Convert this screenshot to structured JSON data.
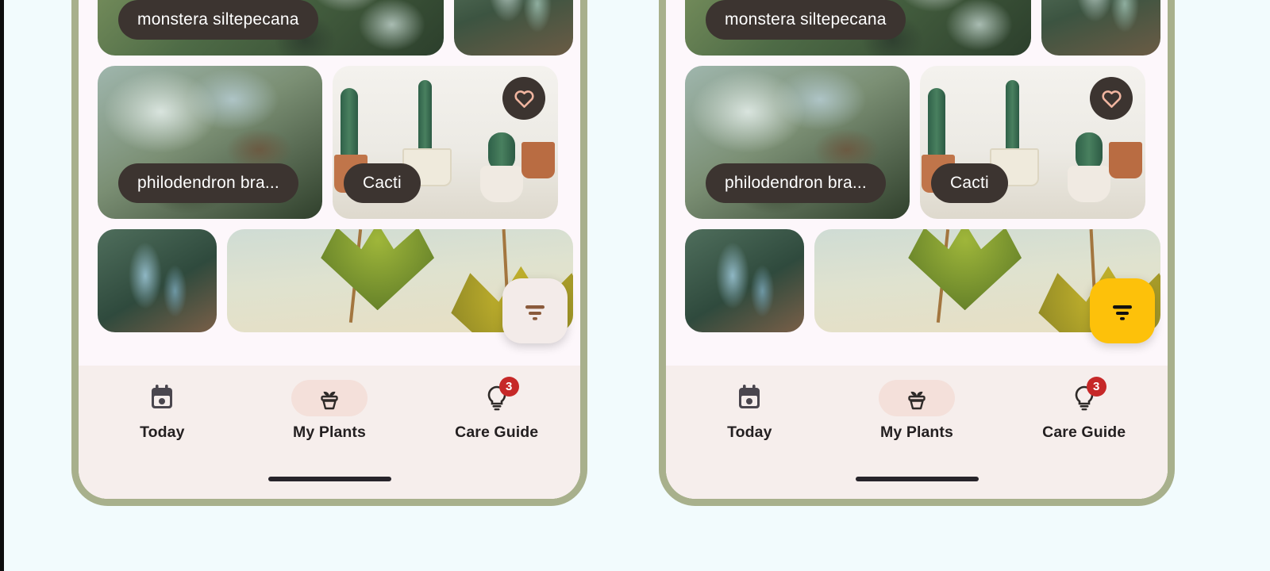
{
  "page": {
    "background_color": "#f2fbfd",
    "edge_strip_color": "#0d0d0d"
  },
  "theme": {
    "frame_color": "#a8b08c",
    "screen_bg": "#fdf7fb",
    "pill_bg": "#3c3430",
    "pill_text": "#ffffff",
    "nav_bg": "#f6eeec",
    "nav_active_pill": "#f4e0da",
    "badge_color": "#c62828",
    "heart_color": "#f0b5a0",
    "fab_left_bg": "#f3ebe9",
    "fab_left_icon": "#8a5a3b",
    "fab_right_bg": "#fdc10a",
    "fab_right_icon": "#111111"
  },
  "panels": [
    {
      "id": "panel-before",
      "fab": {
        "name": "filter-fab",
        "icon": "filter-icon",
        "background": "#f3ebe9",
        "icon_color": "#8a5a3b"
      }
    },
    {
      "id": "panel-after",
      "fab": {
        "name": "filter-fab",
        "icon": "filter-icon",
        "background": "#fdc10a",
        "icon_color": "#111111"
      }
    }
  ],
  "plant_grid": {
    "cards": [
      {
        "label": "monstera siltepecana",
        "has_label": true,
        "favorited": false,
        "image": "monstera-leaves"
      },
      {
        "label": "",
        "has_label": false,
        "favorited": false,
        "image": "palm-fronds"
      },
      {
        "label": "philodendron bra...",
        "has_label": true,
        "favorited": false,
        "image": "philodendron-pots"
      },
      {
        "label": "Cacti",
        "has_label": true,
        "favorited": true,
        "image": "cacti-shelf"
      },
      {
        "label": "",
        "has_label": false,
        "favorited": false,
        "image": "dracaena-spikes"
      },
      {
        "label": "",
        "has_label": false,
        "favorited": false,
        "image": "maple-leaves"
      }
    ]
  },
  "bottom_nav": {
    "items": [
      {
        "label": "Today",
        "icon": "calendar-icon",
        "active": false,
        "badge": null
      },
      {
        "label": "My Plants",
        "icon": "potted-plant-icon",
        "active": true,
        "badge": null
      },
      {
        "label": "Care Guide",
        "icon": "lightbulb-icon",
        "active": false,
        "badge": "3"
      }
    ],
    "home_indicator": true
  }
}
